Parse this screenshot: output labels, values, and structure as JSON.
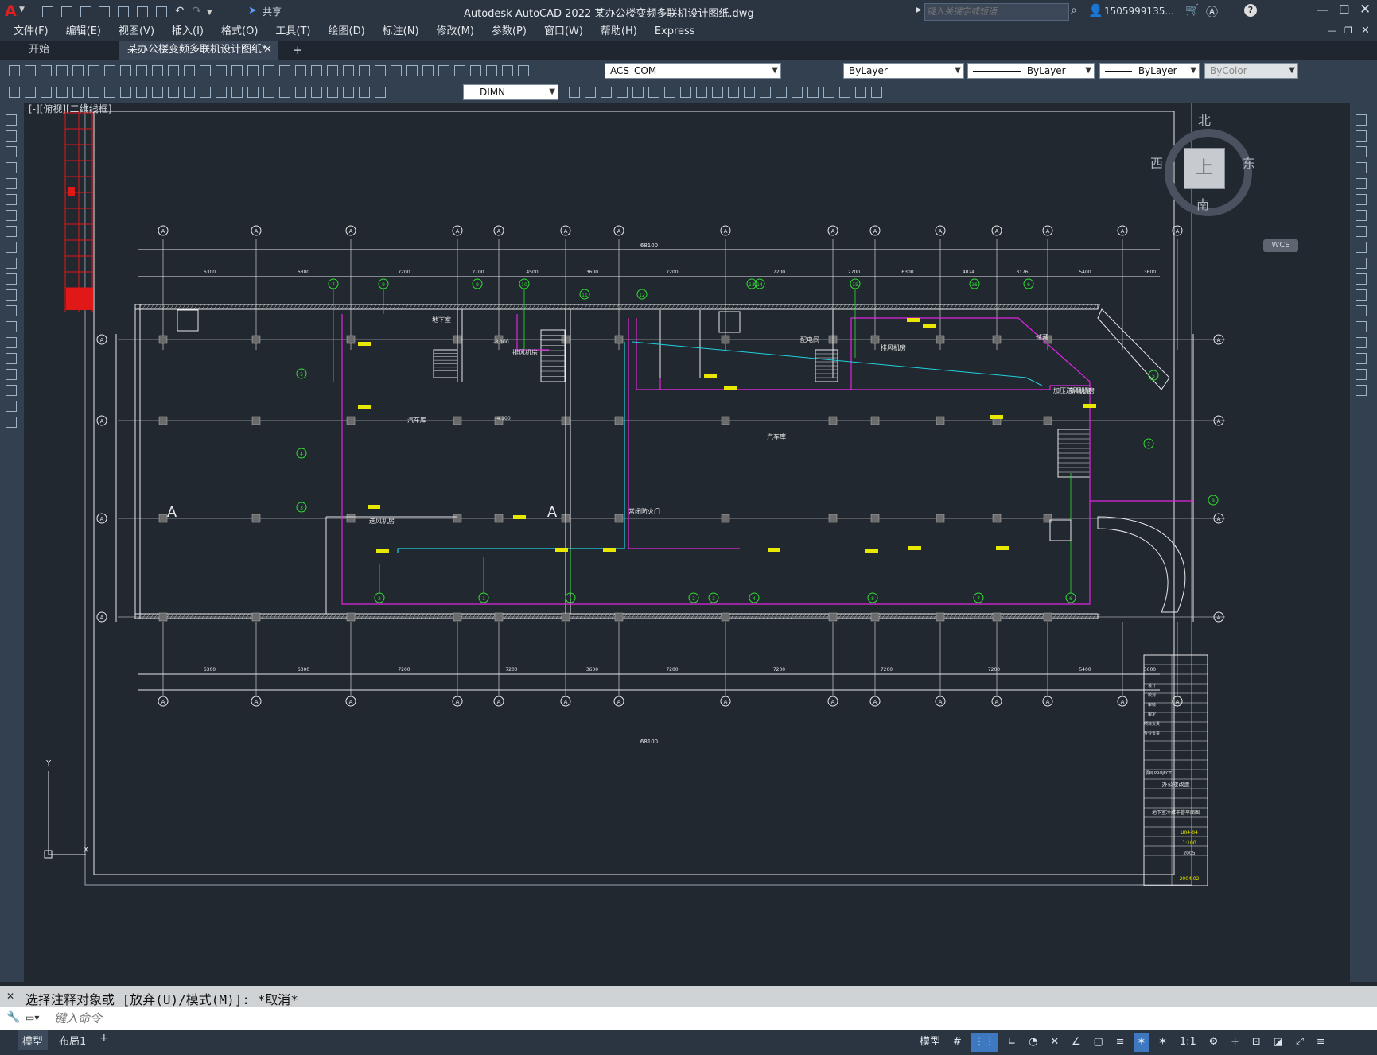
{
  "app": {
    "title": "Autodesk AutoCAD 2022    某办公楼变频多联机设计图纸.dwg",
    "share_label": "共享",
    "search_placeholder": "键入关键字或短语",
    "user": "1505999135...",
    "help_icon": "?"
  },
  "menu": [
    "文件(F)",
    "编辑(E)",
    "视图(V)",
    "插入(I)",
    "格式(O)",
    "工具(T)",
    "绘图(D)",
    "标注(N)",
    "修改(M)",
    "参数(P)",
    "窗口(W)",
    "帮助(H)",
    "Express"
  ],
  "tabs": [
    {
      "label": "开始",
      "active": false
    },
    {
      "label": "某办公楼变频多联机设计图纸*",
      "active": true
    }
  ],
  "toolbar": {
    "ucs_combo": "ACS_COM",
    "layer_combo": "ByLayer",
    "linetype_combo": "ByLayer",
    "lineweight_combo": "ByLayer",
    "color_combo": "ByColor",
    "dimstyle_combo": "DIMN"
  },
  "viewport_label": "[-][俯视][二维线框]",
  "viewcube": {
    "north": "北",
    "south": "南",
    "east": "东",
    "west": "西",
    "top": "上",
    "wcs": "WCS"
  },
  "drawing": {
    "top_dims": [
      "6300",
      "6300",
      "7200",
      "2700",
      "4500",
      "3600",
      "7200",
      "7200",
      "2700",
      "6300",
      "4024",
      "3176",
      "5400",
      "3600"
    ],
    "bottom_dims": [
      "6300",
      "6300",
      "7200",
      "7200",
      "3600",
      "7200",
      "7200",
      "7200",
      "7200",
      "5400",
      "3600"
    ],
    "overall_dim": "68100",
    "grid_bubble": "A",
    "room_labels": [
      "排风机房",
      "地下室",
      "配电间",
      "排风机房",
      "新风机房",
      "汽车库",
      "汽车库",
      "送风机房",
      "常闭防火门",
      "储藏",
      "加压送风机房"
    ],
    "level_1": "-3.100",
    "level_2": "-4.100",
    "circuit_labels": [
      "7",
      "9",
      "9",
      "10",
      "11",
      "12",
      "13",
      "14",
      "15",
      "16",
      "6",
      "5",
      "4",
      "3",
      "2",
      "1",
      "1",
      "2",
      "3",
      "4",
      "8",
      "7",
      "6",
      "5"
    ]
  },
  "titleblock": {
    "project_label": "项目 PROJECT",
    "project": "办公楼改造",
    "drawing_title": "地下室冷媒干管平面图",
    "drawing_no": "U04-04",
    "scale": "1:100",
    "year": "2005",
    "date": "2004.02",
    "rows": [
      "设计",
      "校对",
      "审核",
      "审定",
      "项目负责",
      "专业负责"
    ]
  },
  "command": {
    "history": "选择注释对象或 [放弃(U)/模式(M)]: *取消*",
    "placeholder": "键入命令"
  },
  "layout_tabs": [
    "模型",
    "布局1"
  ],
  "status": {
    "model": "模型",
    "scale": "1:1"
  },
  "colors": {
    "background": "#212830",
    "chrome": "#2b3441",
    "magenta": "#e024e0",
    "green": "#30e030",
    "cyan": "#20d0e0",
    "yellow": "#e8e800",
    "white": "#e8e8e8",
    "red": "#e01818"
  }
}
